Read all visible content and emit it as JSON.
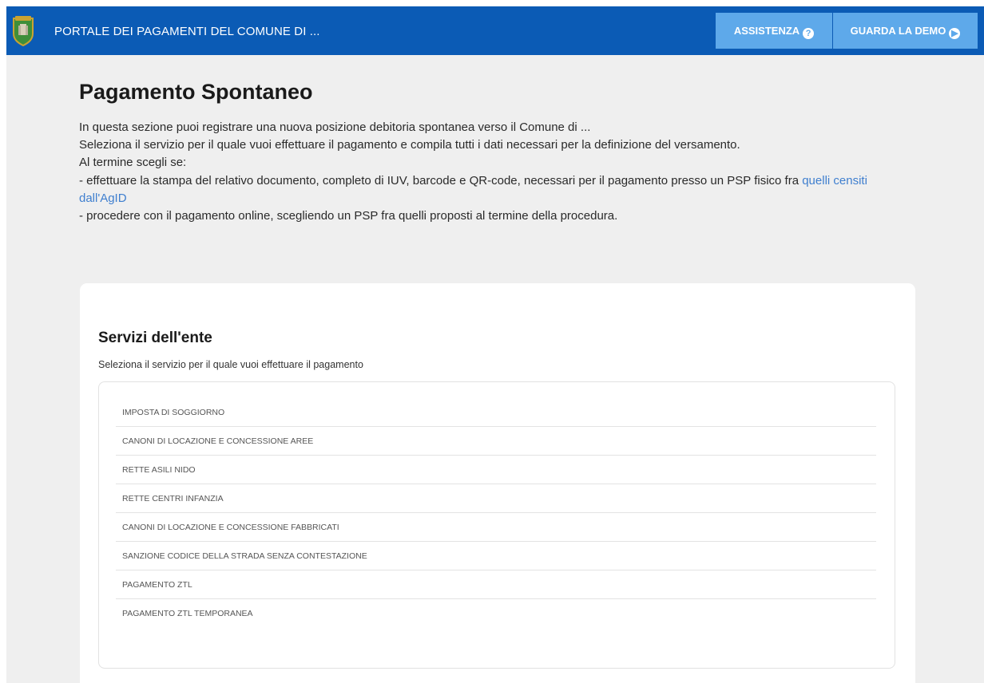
{
  "header": {
    "title": "PORTALE DEI PAGAMENTI DEL COMUNE DI ...",
    "help_label": "ASSISTENZA",
    "demo_label": "GUARDA LA DEMO",
    "help_icon": "question-circle-icon",
    "demo_icon": "play-circle-icon",
    "brand_color": "#0b5bb5",
    "button_color": "#5ea9ea"
  },
  "main": {
    "heading": "Pagamento Spontaneo",
    "intro_line1": "In questa sezione puoi registrare una nuova posizione debitoria spontanea verso il Comune di ...",
    "intro_line2": "Seleziona il servizio per il quale vuoi effettuare il pagamento e compila tutti i dati necessari per la definizione del versamento.",
    "intro_line3": "Al termine scegli se:",
    "intro_line4_text": "- effettuare la stampa del relativo documento, completo di IUV, barcode e QR-code, necessari per il pagamento presso un PSP fisico fra ",
    "intro_line4_link": "quelli censiti dall'AgID",
    "intro_line5": "- procedere con il pagamento online, scegliendo un PSP fra quelli proposti al termine della procedura."
  },
  "services": {
    "title": "Servizi dell'ente",
    "subtitle": "Seleziona il servizio per il quale vuoi effettuare il pagamento",
    "items": [
      "IMPOSTA DI SOGGIORNO",
      "CANONI DI LOCAZIONE E CONCESSIONE AREE",
      "RETTE ASILI NIDO",
      "RETTE CENTRI INFANZIA",
      "CANONI DI LOCAZIONE E CONCESSIONE FABBRICATI",
      "SANZIONE CODICE DELLA STRADA SENZA CONTESTAZIONE",
      "PAGAMENTO ZTL",
      "PAGAMENTO ZTL TEMPORANEA"
    ]
  }
}
